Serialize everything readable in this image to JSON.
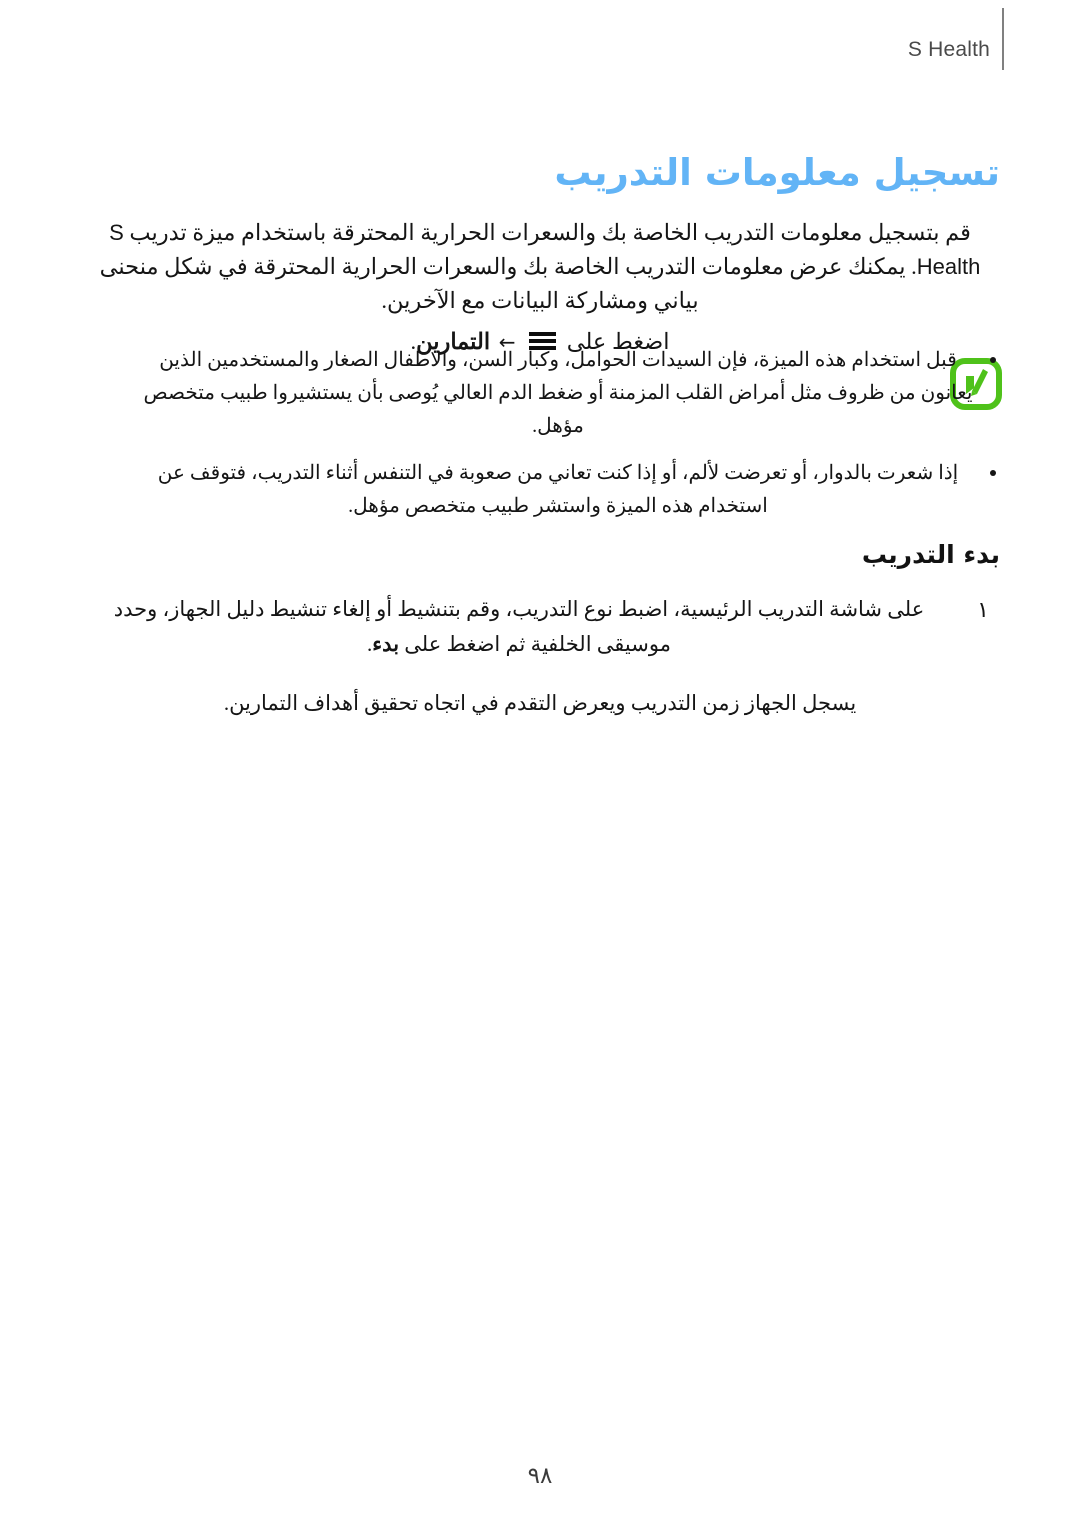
{
  "header": {
    "title": "S Health",
    "divider": "vertical-rule"
  },
  "title": "تسجيل معلومات التدريب",
  "intro": {
    "before_brand": "قم بتسجيل معلومات التدريب الخاصة بك والسعرات الحرارية المحترقة باستخدام ميزة تدريب ",
    "brand": "S Health",
    "after_brand": ". يمكنك عرض معلومات التدريب الخاصة بك والسعرات الحرارية المحترقة في شكل منحنى بياني ومشاركة البيانات مع الآخرين."
  },
  "tap_instruction": {
    "prefix": "اضغط على",
    "menu_icon": "hamburger-menu-icon",
    "arrow": "←",
    "target": "التمارين",
    "suffix": "."
  },
  "note": {
    "icon": "note-pencil-icon",
    "icon_color": "#4fc21a",
    "bullets": [
      "قبل استخدام هذه الميزة، فإن السيدات الحوامل، وكبار السن، والاطفال الصغار والمستخدمين الذين يعانون من ظروف مثل أمراض القلب المزمنة أو ضغط الدم العالي يُوصى بأن يستشيروا طبيب متخصص مؤهل.",
      "إذا شعرت بالدوار، أو تعرضت لألم، أو إذا كنت تعاني من صعوبة في التنفس أثناء التدريب، فتوقف عن استخدام هذه الميزة واستشر طبيب متخصص مؤهل."
    ]
  },
  "sub_heading": "بدء التدريب",
  "steps": [
    {
      "number": "١",
      "text_before_bold": "على شاشة التدريب الرئيسية، اضبط نوع التدريب، وقم بتنشيط أو إلغاء تنشيط دليل الجهاز، وحدد موسيقى الخلفية ثم اضغط على ",
      "bold_term": "بدء",
      "text_after_bold": "."
    }
  ],
  "closing_note": "يسجل الجهاز زمن التدريب ويعرض التقدم في اتجاه تحقيق أهداف التمارين.",
  "page_number": "٩٨",
  "colors": {
    "title_blue": "#62b4f6",
    "note_green": "#4fc21a",
    "body_text": "#151515",
    "header_text": "#4a4a4a"
  }
}
